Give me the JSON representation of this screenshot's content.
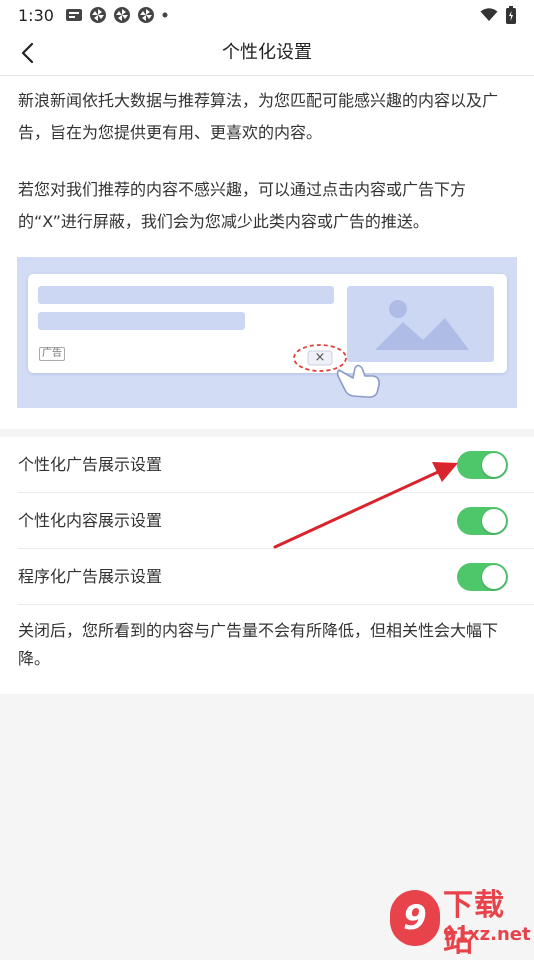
{
  "status_bar": {
    "time": "1:30",
    "icons": [
      "news-app-icon",
      "pinwheel-icon",
      "pinwheel-icon",
      "pinwheel-icon",
      "dot-icon"
    ],
    "right_icons": [
      "wifi-icon",
      "battery-icon"
    ]
  },
  "nav": {
    "back_icon": "chevron-left-icon",
    "title": "个性化设置"
  },
  "intro": {
    "paragraph1": " 新浪新闻依托大数据与推荐算法，为您匹配可能感兴趣的内容以及广告，旨在为您提供更有用、更喜欢的内容。",
    "paragraph2": "若您对我们推荐的内容不感兴趣，可以通过点击内容或广告下方的“X”进行屏蔽，我们会为您减少此类内容或广告的推送。",
    "illustration": {
      "ad_tag": "广告",
      "close_glyph": "×",
      "colors": {
        "background": "#d2dcf4",
        "placeholder": "#ccd7f3",
        "dashed_ring": "#e0413a"
      }
    }
  },
  "settings": {
    "items": [
      {
        "label": "个性化广告展示设置",
        "enabled": true
      },
      {
        "label": "个性化内容展示设置",
        "enabled": true
      },
      {
        "label": "程序化广告展示设置",
        "enabled": true
      }
    ],
    "toggle_on_color": "#4ec66a",
    "note": "关闭后，您所看到的内容与广告量不会有所降低，但相关性会大幅下降。"
  },
  "annotation": {
    "type": "red-arrow",
    "color": "#d9232d",
    "points_to": "个性化广告展示设置"
  },
  "watermark": {
    "logo_glyph": "9",
    "title": "下载站",
    "url": "91xz.net",
    "color": "#e8434b"
  }
}
